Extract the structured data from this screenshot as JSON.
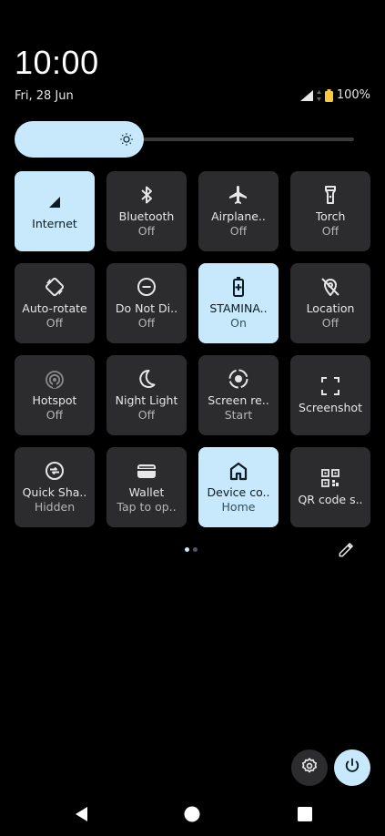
{
  "header": {
    "time": "10:00",
    "date": "Fri, 28 Jun",
    "battery": "100%"
  },
  "brightness": {
    "level": 0.38
  },
  "tiles": [
    {
      "label": "Internet",
      "sub": "",
      "active": true,
      "icon": "signal-icon"
    },
    {
      "label": "Bluetooth",
      "sub": "Off",
      "active": false,
      "icon": "bluetooth-icon"
    },
    {
      "label": "Airplane..",
      "sub": "Off",
      "active": false,
      "icon": "airplane-icon"
    },
    {
      "label": "Torch",
      "sub": "Off",
      "active": false,
      "icon": "torch-icon"
    },
    {
      "label": "Auto-rotate",
      "sub": "Off",
      "active": false,
      "icon": "auto-rotate-icon"
    },
    {
      "label": "Do Not Di..",
      "sub": "Off",
      "active": false,
      "icon": "do-not-disturb-icon"
    },
    {
      "label": "STAMINA..",
      "sub": "On",
      "active": true,
      "icon": "battery-saver-icon"
    },
    {
      "label": "Location",
      "sub": "Off",
      "active": false,
      "icon": "location-off-icon"
    },
    {
      "label": "Hotspot",
      "sub": "Off",
      "active": false,
      "icon": "hotspot-icon"
    },
    {
      "label": "Night Light",
      "sub": "Off",
      "active": false,
      "icon": "moon-icon"
    },
    {
      "label": "Screen re..",
      "sub": "Start",
      "active": false,
      "icon": "screen-record-icon"
    },
    {
      "label": "Screenshot",
      "sub": "",
      "active": false,
      "icon": "screenshot-icon"
    },
    {
      "label": "Quick Sha..",
      "sub": "Hidden",
      "active": false,
      "icon": "quick-share-icon"
    },
    {
      "label": "Wallet",
      "sub": "Tap to op..",
      "active": false,
      "icon": "wallet-icon"
    },
    {
      "label": "Device co..",
      "sub": "Home",
      "active": true,
      "icon": "home-icon"
    },
    {
      "label": "QR code s..",
      "sub": "",
      "active": false,
      "icon": "qr-code-icon"
    }
  ],
  "pager": {
    "pages": 2,
    "current": 0
  },
  "colors": {
    "active_tile": "#c7e9fb",
    "inactive_tile": "#2c2c2e",
    "background": "#000000"
  }
}
